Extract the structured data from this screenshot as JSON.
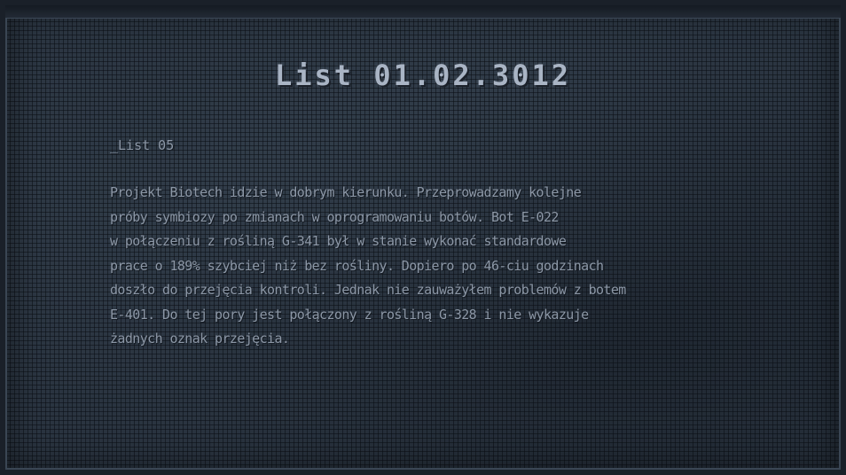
{
  "letter": {
    "title": "List 01.02.3012",
    "label": "_List 05",
    "lines": [
      "Projekt Biotech idzie w dobrym kierunku. Przeprowadzamy kolejne",
      "próby symbiozy po zmianach w oprogramowaniu botów. Bot E-022",
      "w połączeniu z rośliną G-341 był w stanie wykonać standardowe",
      "prace o 189% szybciej niż bez rośliny. Dopiero po 46-ciu godzinach",
      "doszło do przejęcia kontroli. Jednak nie zauważyłem problemów z botem",
      "E-401. Do tej pory jest połączony z rośliną G-328 i nie wykazuje",
      "żadnych oznak przejęcia."
    ]
  },
  "colors": {
    "background": "#2a3440",
    "title": "#a9b4c4",
    "text": "#8c97a6"
  }
}
